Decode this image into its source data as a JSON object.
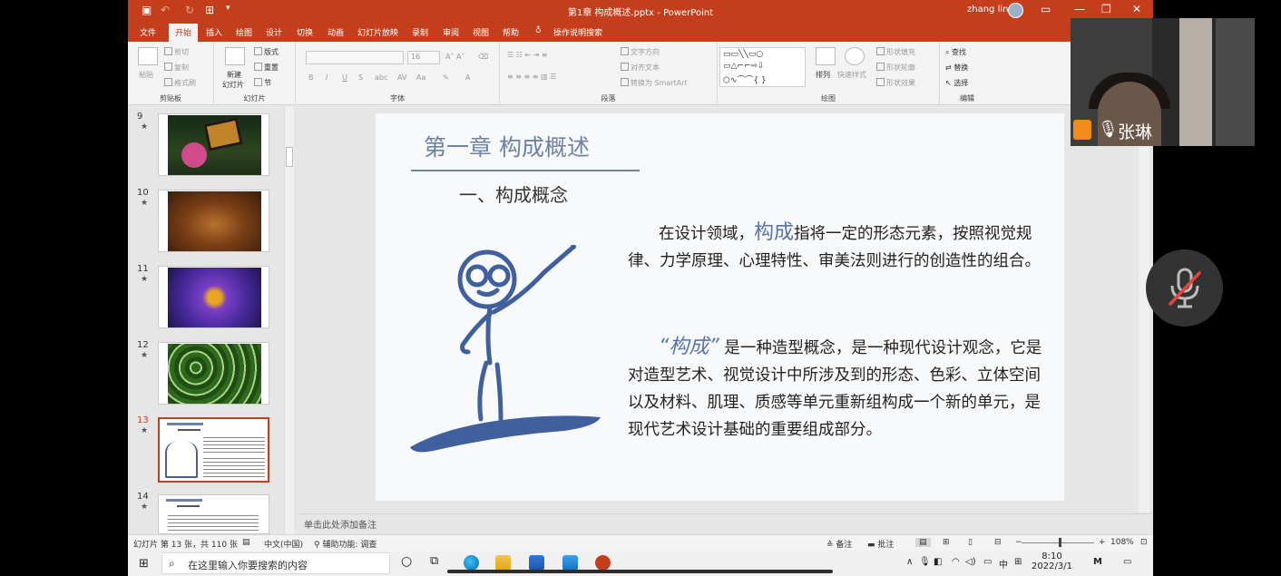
{
  "window": {
    "title": "第1章 构成概述.pptx - PowerPoint",
    "user": "zhang lin",
    "minimize": "—",
    "restore": "❐",
    "close": "✕"
  },
  "tabs": [
    "文件",
    "开始",
    "插入",
    "绘图",
    "设计",
    "切换",
    "动画",
    "幻灯片放映",
    "录制",
    "审阅",
    "视图",
    "帮助"
  ],
  "tell_me": "操作说明搜索",
  "ribbon": {
    "clipboard": {
      "paste": "粘贴",
      "cut": "剪切",
      "copy": "复制",
      "format_painter": "格式刷",
      "label": "剪贴板"
    },
    "slides": {
      "new_slide": "新建",
      "new_slide2": "幻灯片",
      "layout": "版式",
      "reset": "重置",
      "section": "节",
      "label": "幻灯片"
    },
    "font": {
      "size": "16",
      "label": "字体"
    },
    "paragraph": {
      "text_direction": "文字方向",
      "align_text": "对齐文本",
      "convert_smartart": "转换为 SmartArt",
      "label": "段落"
    },
    "drawing": {
      "arrange": "排列",
      "quick_styles": "快速样式",
      "shape_fill": "形状填充",
      "shape_outline": "形状轮廓",
      "shape_effects": "形状效果",
      "label": "绘图"
    },
    "editing": {
      "find": "查找",
      "replace": "替换",
      "select": "选择",
      "label": "编辑"
    }
  },
  "thumbnails": [
    {
      "num": "9",
      "star": "★",
      "kind": "butterfly"
    },
    {
      "num": "10",
      "star": "★",
      "kind": "leopard"
    },
    {
      "num": "11",
      "star": "★",
      "kind": "flower"
    },
    {
      "num": "12",
      "star": "★",
      "kind": "leaves"
    },
    {
      "num": "13",
      "star": "★",
      "kind": "current"
    },
    {
      "num": "14",
      "star": "★",
      "kind": "text"
    }
  ],
  "slide": {
    "title": "第一章 构成概述",
    "subtitle": "一、构成概念",
    "p1_lead": "在设计领域，",
    "p1_keyword": "构成",
    "p1_rest": "指将一定的形态元素，按照视觉规律、力学原理、心理特性、审美法则进行的创造性的组合。",
    "p2_keyword": "“构成”",
    "p2_rest": " 是一种造型概念，是一种现代设计观念，它是对造型艺术、视觉设计中所涉及到的形态、色彩、立体空间以及材料、肌理、质感等单元重新组构成一个新的单元，是现代艺术设计基础的重要组成部分。"
  },
  "notes_placeholder": "单击此处添加备注",
  "status": {
    "slide_count": "幻灯片 第 13 张，共 110 张",
    "language": "中文(中国)",
    "accessibility": "辅助功能: 调查",
    "notes": "备注",
    "comments": "批注",
    "zoom": "108%"
  },
  "meeting": {
    "participant_name": "张琳"
  },
  "taskbar": {
    "search_placeholder": "在这里输入你要搜索的内容",
    "time": "8:10",
    "date": "2022/3/1",
    "ime": "中"
  },
  "colors": {
    "ppt_accent": "#c43e1c",
    "slide_title": "#6d82a6",
    "keyword": "#5873a8",
    "stickman": "#3f5f9d"
  }
}
